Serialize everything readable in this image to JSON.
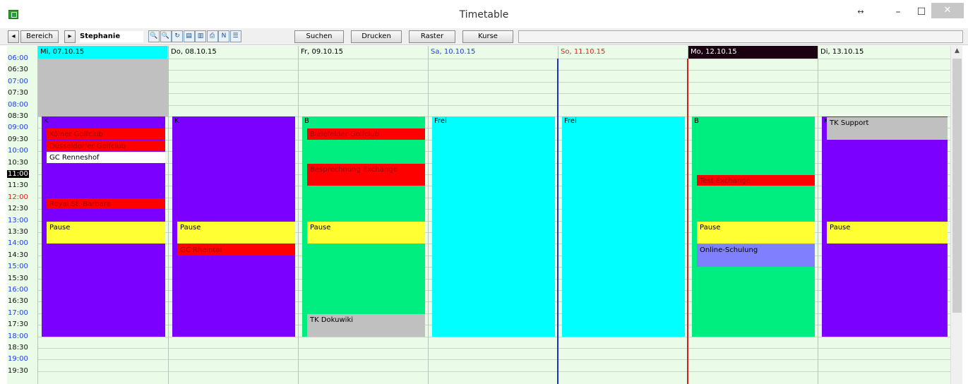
{
  "window": {
    "title": "Timetable",
    "restore_glyph": "↔",
    "minimize_glyph": "–",
    "maximize_glyph": "☐",
    "close_glyph": "✕",
    "app_icon": "calendar-app-icon"
  },
  "toolbar": {
    "prev_glyph": "◂",
    "area_label": "Bereich",
    "next_glyph": "▸",
    "user": "Stephanie",
    "icons": [
      "zoom-in-icon",
      "zoom-out-icon",
      "refresh-icon",
      "calendar-icon",
      "grid-icon",
      "print-icon",
      "n-icon",
      "layout-icon"
    ],
    "icon_glyphs": [
      "🔍",
      "🔍",
      "↻",
      "▤",
      "▥",
      "⎙",
      "N",
      "☰"
    ],
    "search": "Suchen",
    "print": "Drucken",
    "raster": "Raster",
    "courses": "Kurse"
  },
  "times": [
    "06:00",
    "06:30",
    "07:00",
    "07:30",
    "08:00",
    "08:30",
    "09:00",
    "09:30",
    "10:00",
    "10:30",
    "11:00",
    "11:30",
    "12:00",
    "12:30",
    "13:00",
    "13:30",
    "14:00",
    "14:30",
    "15:00",
    "15:30",
    "16:00",
    "16:30",
    "17:00",
    "17:30",
    "18:00",
    "18:30",
    "19:00",
    "19:30"
  ],
  "current_time": "11:00",
  "days": [
    {
      "label": "Mi, 07.10.15",
      "shift": "K",
      "color": "#7b00ff",
      "header_bg": "#00ffff",
      "header_fg": "#000000"
    },
    {
      "label": "Do, 08.10.15",
      "shift": "K",
      "color": "#7b00ff",
      "header_bg": "#eafbe8",
      "header_fg": "#000000"
    },
    {
      "label": "Fr, 09.10.15",
      "shift": "B",
      "color": "#00ee80",
      "header_bg": "#eafbe8",
      "header_fg": "#000000"
    },
    {
      "label": "Sa, 10.10.15",
      "shift": "Frei",
      "color": "#00ffff",
      "header_bg": "#eafbe8",
      "header_fg": "#1f3fe0"
    },
    {
      "label": "So, 11.10.15",
      "shift": "Frei",
      "color": "#00ffff",
      "header_bg": "#eafbe8",
      "header_fg": "#e02020"
    },
    {
      "label": "Mo, 12.10.15",
      "shift": "B",
      "color": "#00ee80",
      "header_bg": "#1a0010",
      "header_fg": "#ffffff"
    },
    {
      "label": "Di, 13.10.15",
      "shift": "K",
      "color": "#7b00ff",
      "header_bg": "#eafbe8",
      "header_fg": "#000000"
    }
  ],
  "events": [
    {
      "day": 0,
      "title": "Kölner Golfclub",
      "color": "#ff0000",
      "fg": "#a00000",
      "start": "09:00",
      "end": "09:30"
    },
    {
      "day": 0,
      "title": "Düsseldorfer Golfclub",
      "color": "#ff0000",
      "fg": "#a00000",
      "start": "09:30",
      "end": "10:00"
    },
    {
      "day": 0,
      "title": "GC Renneshof",
      "color": "#ffffff",
      "fg": "#000000",
      "start": "10:00",
      "end": "10:30"
    },
    {
      "day": 0,
      "title": "Royal St. Barbara",
      "color": "#ff0000",
      "fg": "#a00000",
      "start": "12:00",
      "end": "12:30"
    },
    {
      "day": 0,
      "title": "Pause",
      "color": "#ffff33",
      "fg": "#000000",
      "start": "13:00",
      "end": "14:00"
    },
    {
      "day": 1,
      "title": "Pause",
      "color": "#ffff33",
      "fg": "#000000",
      "start": "13:00",
      "end": "14:00"
    },
    {
      "day": 1,
      "title": "GC Rheintal",
      "color": "#ff0000",
      "fg": "#a00000",
      "start": "14:00",
      "end": "14:30"
    },
    {
      "day": 2,
      "title": "Bielefelder Golfclub",
      "color": "#ff0000",
      "fg": "#a00000",
      "start": "09:00",
      "end": "09:30"
    },
    {
      "day": 2,
      "title": "Besprechnung Exchange",
      "color": "#ff0000",
      "fg": "#a00000",
      "start": "10:30",
      "end": "11:30"
    },
    {
      "day": 2,
      "title": "Pause",
      "color": "#ffff33",
      "fg": "#000000",
      "start": "13:00",
      "end": "14:00"
    },
    {
      "day": 2,
      "title": "TK Dokuwiki",
      "color": "#c0c0c0",
      "fg": "#000000",
      "start": "17:00",
      "end": "18:00"
    },
    {
      "day": 5,
      "title": "Test Exchange",
      "color": "#ff0000",
      "fg": "#a00000",
      "start": "11:00",
      "end": "11:30"
    },
    {
      "day": 5,
      "title": "Pause",
      "color": "#ffff33",
      "fg": "#000000",
      "start": "13:00",
      "end": "14:00"
    },
    {
      "day": 5,
      "title": "Online-Schulung",
      "color": "#8080ff",
      "fg": "#000000",
      "start": "14:00",
      "end": "15:00"
    },
    {
      "day": 6,
      "title": "TK Support",
      "color": "#c0c0c0",
      "fg": "#000000",
      "start": "08:30",
      "end": "09:30"
    },
    {
      "day": 6,
      "title": "Pause",
      "color": "#ffff33",
      "fg": "#000000",
      "start": "13:00",
      "end": "14:00"
    }
  ],
  "shift_start": "08:30",
  "shift_end": "18:00",
  "blocked": {
    "day": 0,
    "start": "06:00",
    "end": "08:30",
    "color": "#c0c0c0"
  },
  "dividers": [
    {
      "after_day": 3,
      "color": "#1f2fd0"
    },
    {
      "after_day": 4,
      "color": "#d02020"
    }
  ]
}
